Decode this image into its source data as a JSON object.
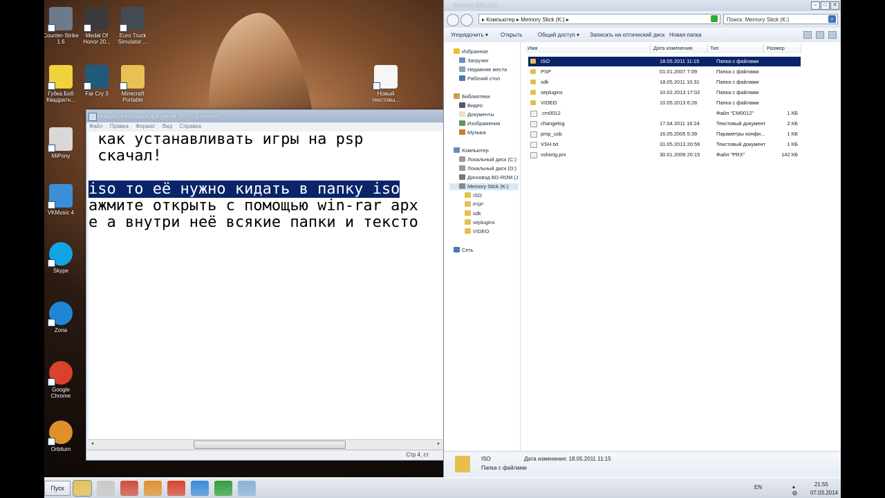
{
  "desktop": {
    "icons": [
      {
        "label": "Counter-Strike 1.6",
        "icon": "cs-icon",
        "color": "#6c7a8a"
      },
      {
        "label": "Medal Of Honor 20...",
        "icon": "medal-of-honor-icon",
        "color": "#3b3b3b"
      },
      {
        "label": "Euro Truck Simulator ...",
        "icon": "truck-icon",
        "color": "#444b55"
      },
      {
        "label": "Губка Боб Квадратн...",
        "icon": "spongebob-icon",
        "color": "#f2d23c"
      },
      {
        "label": "Far Cry 3",
        "icon": "farcry-icon",
        "color": "#1f5a7a"
      },
      {
        "label": "Minecraft Portable",
        "icon": "folder-icon",
        "color": "#e8c152"
      },
      {
        "label": "Новый текстовы...",
        "icon": "text-file-icon",
        "color": "#f6f6f6"
      },
      {
        "label": "MiPony",
        "icon": "mipony-icon",
        "color": "#d8d8d8"
      },
      {
        "label": "VKMusic 4",
        "icon": "vkmusic-icon",
        "color": "#3b8fd9"
      },
      {
        "label": "Skype",
        "icon": "skype-icon",
        "color": "#12a5e6"
      },
      {
        "label": "Zona",
        "icon": "zona-icon",
        "color": "#1f86d6"
      },
      {
        "label": "Google Chrome",
        "icon": "chrome-icon",
        "color": "#d9422c"
      },
      {
        "label": "Orbitum",
        "icon": "orbitum-icon",
        "color": "#e0902a"
      }
    ]
  },
  "notepad": {
    "title": "Новый текстовый документ (3) — Блокнот",
    "menu": [
      "Файл",
      "Правка",
      "Формат",
      "Вид",
      "Справка"
    ],
    "lines": [
      " как устанавливать игры на psp",
      " скачал!",
      "",
      "iso то её нужно кидать в папку iso",
      "ажмите открыть с помощью win-rar арх",
      "е а внутри неё всякие папки и тексто"
    ],
    "status": "Стр 4, ст"
  },
  "explorer": {
    "title": "Memory Stick (K:)",
    "address": "▸ Компьютер ▸ Memory Stick (K:) ▸",
    "search_placeholder": "Поиск: Memory Stick (K:)",
    "toolbar": [
      "Упорядочить ▾",
      "Открыть",
      "Общий доступ ▾",
      "Записать на оптический диск",
      "Новая папка"
    ],
    "nav": {
      "favorites": "Избранное",
      "fav_items": [
        "Загрузки",
        "Недавние места",
        "Рабочий стол"
      ],
      "libraries": "Библиотеки",
      "lib_items": [
        "Видео",
        "Документы",
        "Изображения",
        "Музыка"
      ],
      "computer": "Компьютер",
      "comp_items": [
        "Локальный диск (C:)",
        "Локальный диск (D:)",
        "Дисковод BD-ROM (J",
        "Memory Stick (K:)"
      ],
      "stick_items": [
        "ISO",
        "PSP",
        "sdk",
        "seplugins",
        "VIDEO"
      ],
      "network": "Сеть"
    },
    "columns": [
      "Имя",
      "Дата изменения",
      "Тип",
      "Размер"
    ],
    "files": [
      {
        "name": "ISO",
        "date": "18.05.2011 11:15",
        "type": "Папка с файлами",
        "size": "",
        "folder": true
      },
      {
        "name": "PSP",
        "date": "01.01.2007 7:09",
        "type": "Папка с файлами",
        "size": "",
        "folder": true
      },
      {
        "name": "sdk",
        "date": "18.05.2011 10:31",
        "type": "Папка с файлами",
        "size": "",
        "folder": true
      },
      {
        "name": "seplugins",
        "date": "10.02.2013 17:02",
        "type": "Папка с файлами",
        "size": "",
        "folder": true
      },
      {
        "name": "VIDEO",
        "date": "10.05.2013 6:28",
        "type": "Папка с файлами",
        "size": "",
        "folder": true
      },
      {
        "name": ".cm0012",
        "date": "",
        "type": "Файл \"CM0012\"",
        "size": "1 КБ",
        "folder": false
      },
      {
        "name": "changelog",
        "date": "17.04.2011 16:24",
        "type": "Текстовый документ",
        "size": "2 КБ",
        "folder": false
      },
      {
        "name": "pmp_usb",
        "date": "16.05.2005 5:39",
        "type": "Параметры конфи...",
        "size": "1 КБ",
        "folder": false
      },
      {
        "name": "VSH.txt",
        "date": "31.05.2013 20:56",
        "type": "Текстовый документ",
        "size": "1 КБ",
        "folder": false
      },
      {
        "name": "vshorig.prx",
        "date": "30.01.2009 20:15",
        "type": "Файл \"PRX\"",
        "size": "142 КБ",
        "folder": false
      }
    ],
    "details": {
      "name": "ISO",
      "modified": "Дата изменения: 18.05.2011 11:15",
      "kind": "Папка с файлами"
    }
  },
  "taskbar": {
    "start": "Пуск",
    "apps": [
      {
        "icon": "explorer-taskbar-icon",
        "color": "#e8c152"
      },
      {
        "icon": "media-player-icon",
        "color": "#c8c8c8"
      },
      {
        "icon": "game-taskbar-icon",
        "color": "#d24a3a"
      },
      {
        "icon": "orbitum-taskbar-icon",
        "color": "#e0902a"
      },
      {
        "icon": "chrome-taskbar-icon",
        "color": "#d9422c"
      },
      {
        "icon": "app-taskbar-icon",
        "color": "#3a8ad6"
      },
      {
        "icon": "autocad-taskbar-icon",
        "color": "#2e9e3a"
      },
      {
        "icon": "notepad-taskbar-icon",
        "color": "#8ab0d8"
      }
    ],
    "lang": "EN",
    "time": "21:55",
    "date": "07.03.2014"
  }
}
